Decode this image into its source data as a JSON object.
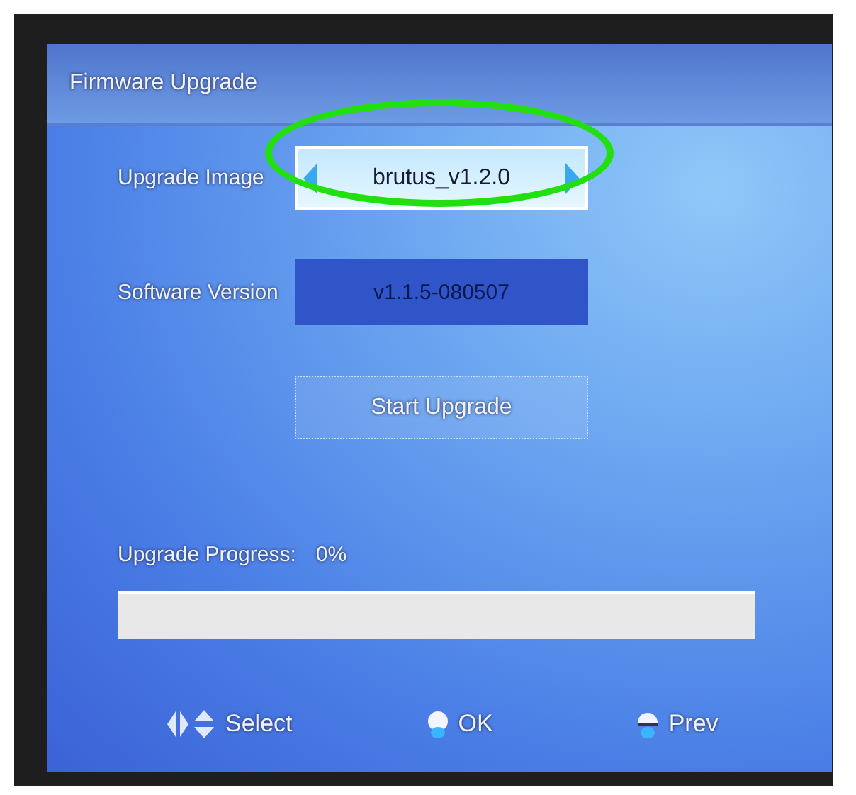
{
  "window": {
    "title": "Firmware Upgrade"
  },
  "upgrade_image": {
    "label": "Upgrade Image",
    "value": "brutus_v1.2.0"
  },
  "software_version": {
    "label": "Software Version",
    "value": "v1.1.5-080507"
  },
  "start_button": {
    "label": "Start Upgrade"
  },
  "progress": {
    "label": "Upgrade Progress:",
    "reading": "0%",
    "level": 0
  },
  "hints": [
    {
      "kind": "arrows",
      "label": "Select"
    },
    {
      "kind": "ok",
      "label": "OK"
    },
    {
      "kind": "menu",
      "label": "Prev"
    }
  ]
}
